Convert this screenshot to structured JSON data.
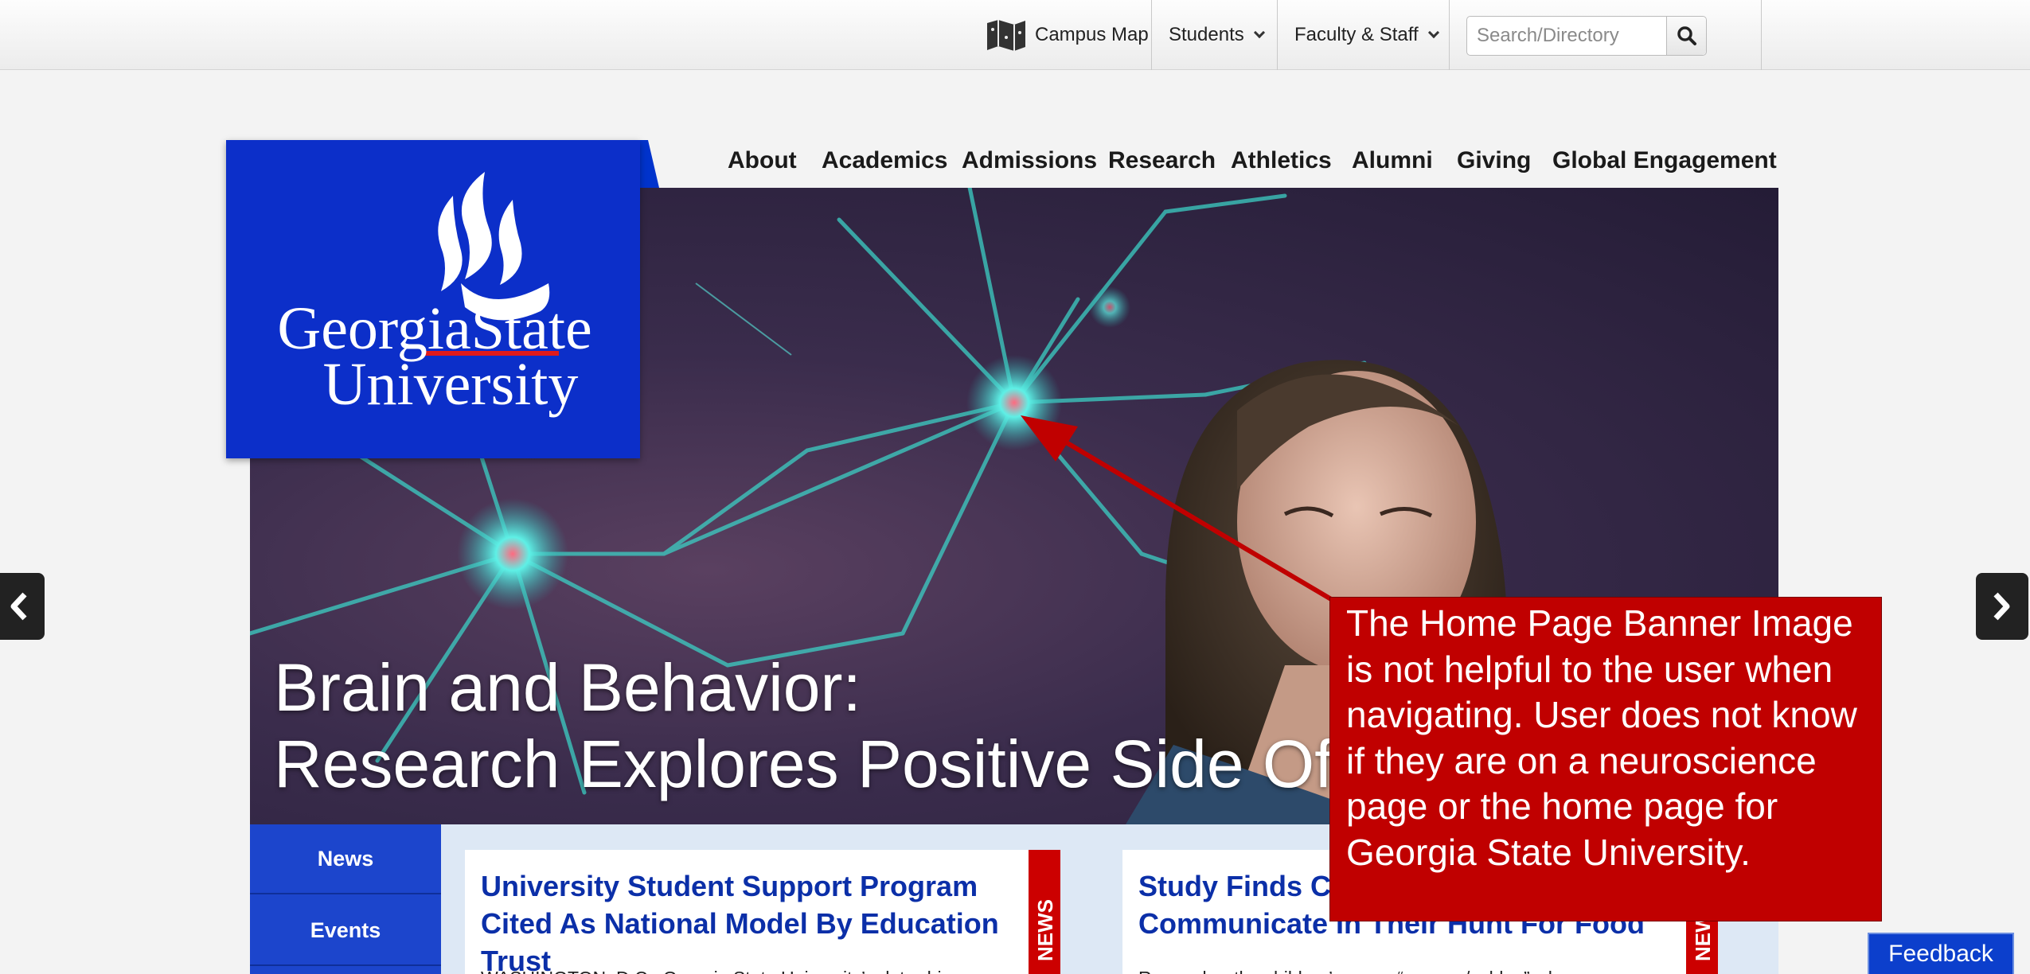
{
  "utility_bar": {
    "campus_map": "Campus Map",
    "students": "Students",
    "faculty_staff": "Faculty & Staff",
    "search_placeholder": "Search/Directory"
  },
  "main_nav": [
    {
      "label": "About"
    },
    {
      "label": "Academics"
    },
    {
      "label": "Admissions"
    },
    {
      "label": "Research"
    },
    {
      "label": "Athletics"
    },
    {
      "label": "Alumni"
    },
    {
      "label": "Giving"
    },
    {
      "label": "Global Engagement"
    }
  ],
  "logo": {
    "line1": "GeorgiaState",
    "line2": "University"
  },
  "hero": {
    "headline_line1": "Brain and Behavior:",
    "headline_line2": "Research Explores Positive Side Of Hu"
  },
  "annotation": {
    "text": "The Home Page Banner Image is not helpful to the user when navigating. User does not know if they are on a neuroscience page or the home page for Georgia State University."
  },
  "tabs": [
    {
      "label": "News"
    },
    {
      "label": "Events"
    }
  ],
  "cards": [
    {
      "title": "University Student Support Program Cited As National Model By Education Trust",
      "text": "WASHINGTON, D.C.–Georgia State University’s data-driven",
      "stripe": "NEWS"
    },
    {
      "title": "Study Finds Chi",
      "title_tail": "Communicate In Their Hunt For Food",
      "text": "Remember the children’s game “warmer/colder,” where one person",
      "stripe": "NEWS"
    }
  ],
  "feedback": "Feedback",
  "colors": {
    "brand_blue": "#0c2fc9",
    "callout_red": "#c00000",
    "news_red": "#cc0000"
  }
}
